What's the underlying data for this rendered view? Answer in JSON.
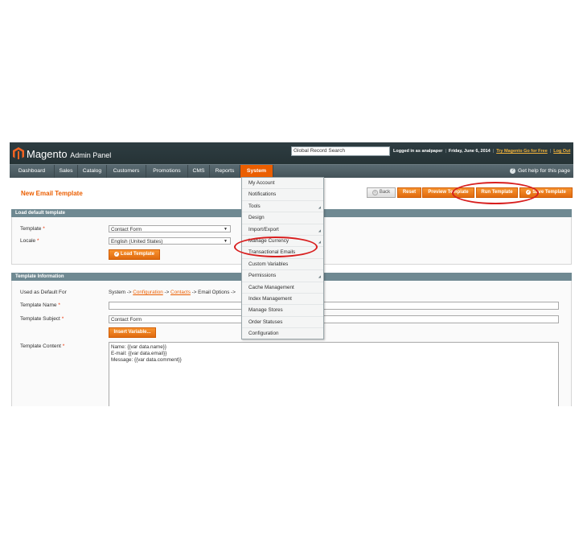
{
  "header": {
    "app_name": "Magento",
    "app_sub": "Admin Panel",
    "search_value": "Global Record Search",
    "logged_in_text": "Logged in as analpaper",
    "date_text": "Friday, June 6, 2014",
    "try_link": "Try Magento Go for Free",
    "logout": "Log Out"
  },
  "nav": {
    "items": [
      "Dashboard",
      "Sales",
      "Catalog",
      "Customers",
      "Promotions",
      "CMS",
      "Reports",
      "System"
    ],
    "help": "Get help for this page"
  },
  "page": {
    "title": "New Email Template",
    "buttons": {
      "back": "Back",
      "reset": "Reset",
      "preview": "Preview Template",
      "run": "Run Template",
      "save": "Save Template"
    }
  },
  "load_section": {
    "heading": "Load default template",
    "template_label": "Template",
    "template_value": "Contact Form",
    "locale_label": "Locale",
    "locale_value": "English (United States)",
    "load_button": "Load Template"
  },
  "info_section": {
    "heading": "Template Information",
    "default_for_label": "Used as Default For",
    "default_for_prefix": "System ->",
    "default_for_link1": "Configuration",
    "default_for_sep": "->",
    "default_for_link2": "Contacts",
    "default_for_suffix": "-> Email Options ->",
    "name_label": "Template Name",
    "name_value": "",
    "subject_label": "Template Subject",
    "subject_value": "Contact Form",
    "insert_variable": "Insert Variable...",
    "content_label": "Template Content",
    "content_lines": [
      "Name: {{var data.name}}",
      "E-mail: {{var data.email}}",
      "",
      "Message: {{var data.comment}}"
    ]
  },
  "system_menu": {
    "items": [
      "My Account",
      "Notifications",
      "Tools",
      "Design",
      "Import/Export",
      "Manage Currency",
      "Transactional Emails",
      "Custom Variables",
      "Permissions",
      "Cache Management",
      "Index Management",
      "Manage Stores",
      "Order Statuses",
      "Configuration"
    ]
  },
  "colors": {
    "accent": "#eb5e00",
    "header_bg": "#2e3d42",
    "section_head": "#6f8992",
    "highlight_ring": "#d81e1e"
  }
}
